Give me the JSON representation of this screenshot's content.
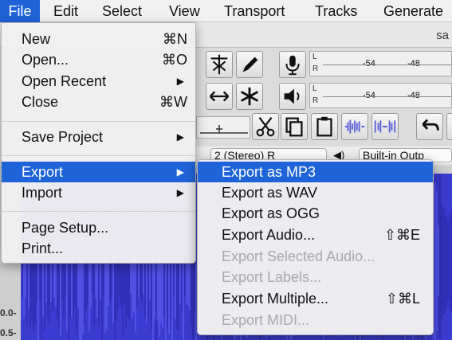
{
  "menubar": {
    "items": [
      "File",
      "Edit",
      "Select",
      "View",
      "Transport",
      "Tracks",
      "Generate"
    ],
    "active_index": 0
  },
  "window": {
    "title_fragment": "sa",
    "meter": {
      "channel_left": "L",
      "channel_right": "R",
      "ticks": [
        "-54",
        "-48"
      ]
    },
    "device_row": {
      "channels_text": "2 (Stereo) R",
      "output_text": "Built-in Outp"
    },
    "vertical_scale": [
      "0.0-",
      "0.5-"
    ]
  },
  "file_menu": {
    "items": [
      {
        "label": "New",
        "shortcut": "⌘N"
      },
      {
        "label": "Open...",
        "shortcut": "⌘O"
      },
      {
        "label": "Open Recent",
        "submenu": true
      },
      {
        "label": "Close",
        "shortcut": "⌘W"
      },
      {
        "label": "Save Project",
        "submenu": true
      },
      {
        "label": "Export",
        "submenu": true,
        "highlighted": true
      },
      {
        "label": "Import",
        "submenu": true
      },
      {
        "label": "Page Setup..."
      },
      {
        "label": "Print..."
      }
    ],
    "arrow": "▶"
  },
  "export_menu": {
    "items": [
      {
        "label": "Export as MP3",
        "highlighted": true
      },
      {
        "label": "Export as WAV"
      },
      {
        "label": "Export as OGG"
      },
      {
        "label": "Export Audio...",
        "shortcut": "⇧⌘E"
      },
      {
        "label": "Export Selected Audio...",
        "disabled": true
      },
      {
        "label": "Export Labels...",
        "disabled": true
      },
      {
        "label": "Export Multiple...",
        "shortcut": "⇧⌘L"
      },
      {
        "label": "Export MIDI...",
        "disabled": true
      }
    ]
  },
  "colors": {
    "highlight": "#1f63d8",
    "waveform": "#3a3bd0",
    "disabled_text": "#a9a9a9"
  }
}
